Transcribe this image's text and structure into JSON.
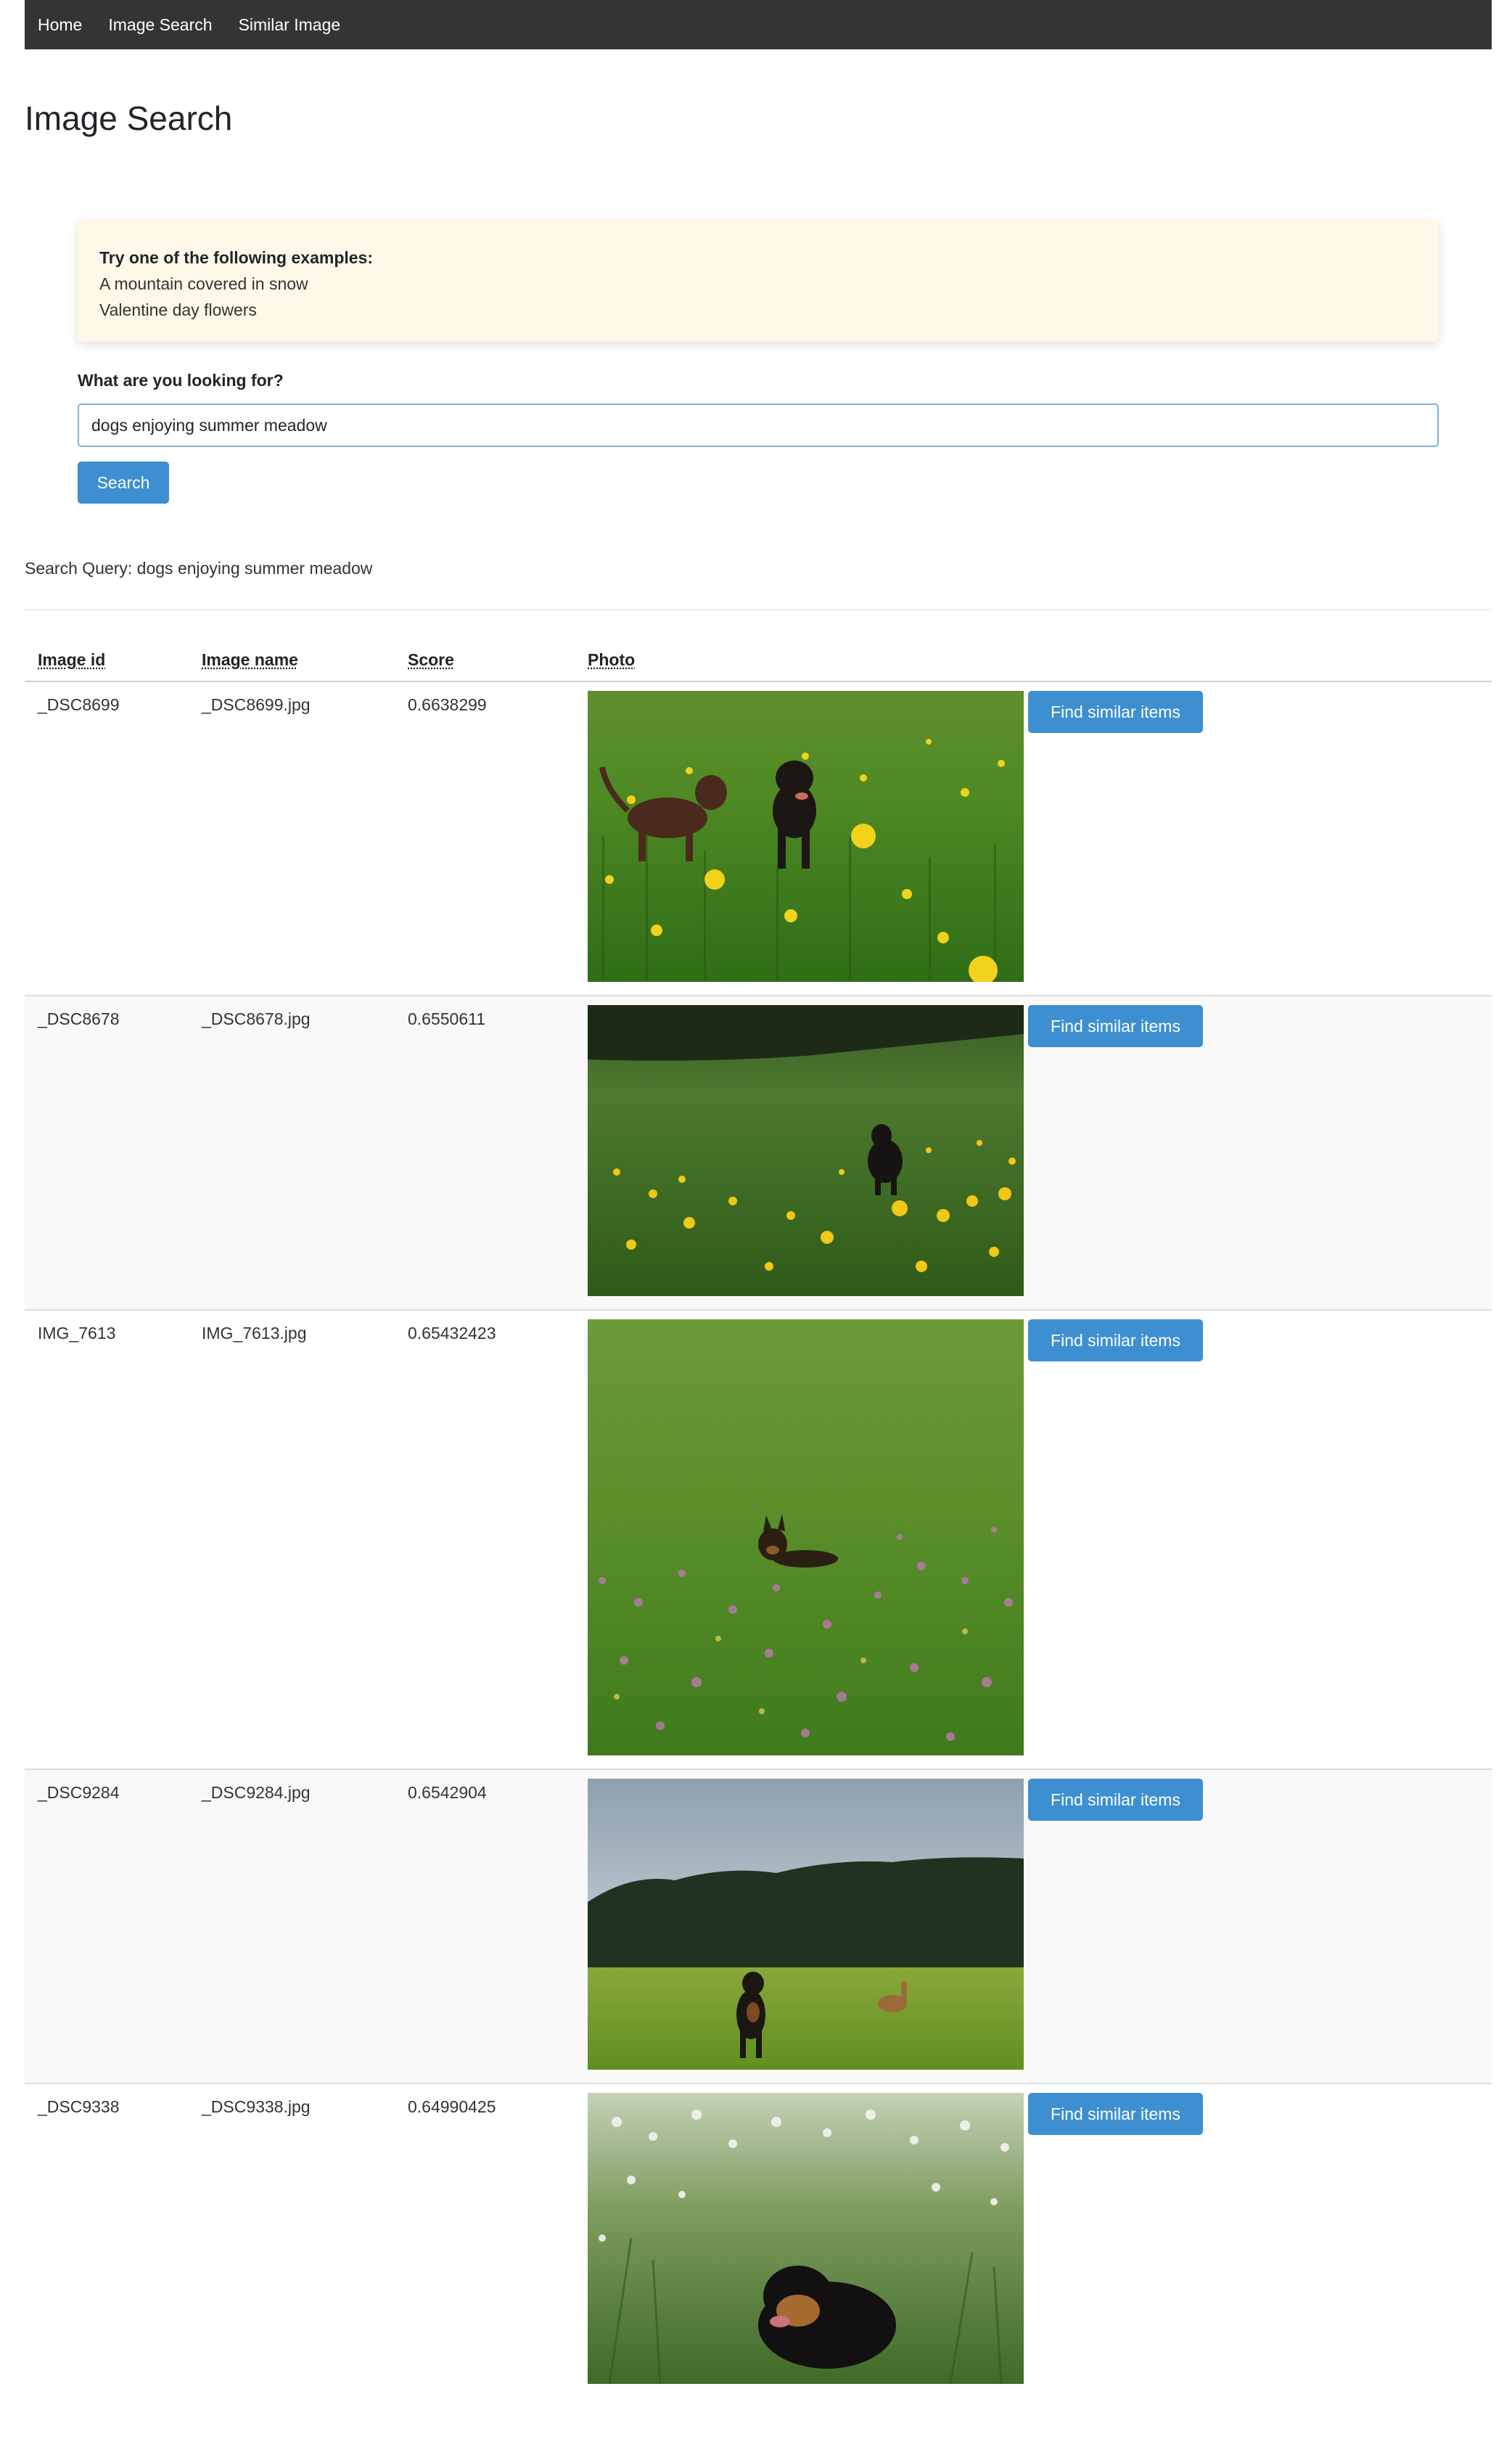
{
  "nav": {
    "items": [
      {
        "label": "Home"
      },
      {
        "label": "Image Search"
      },
      {
        "label": "Similar Image"
      }
    ]
  },
  "page": {
    "title": "Image Search"
  },
  "examples": {
    "heading": "Try one of the following examples:",
    "items": [
      "A mountain covered in snow",
      "Valentine day flowers"
    ]
  },
  "search": {
    "label": "What are you looking for?",
    "value": "dogs enjoying summer meadow",
    "button_label": "Search"
  },
  "query": {
    "text": "Search Query: dogs enjoying summer meadow"
  },
  "table": {
    "headers": [
      "Image id",
      "Image name",
      "Score",
      "Photo"
    ],
    "action_label": "Find similar items",
    "rows": [
      {
        "id": "_DSC8699",
        "name": "_DSC8699.jpg",
        "score": "0.6638299"
      },
      {
        "id": "_DSC8678",
        "name": "_DSC8678.jpg",
        "score": "0.6550611"
      },
      {
        "id": "IMG_7613",
        "name": "IMG_7613.jpg",
        "score": "0.65432423"
      },
      {
        "id": "_DSC9284",
        "name": "_DSC9284.jpg",
        "score": "0.6542904"
      },
      {
        "id": "_DSC9338",
        "name": "_DSC9338.jpg",
        "score": "0.64990425"
      }
    ]
  },
  "colors": {
    "navbar": "#343434",
    "accent": "#3d8fd1",
    "examples_bg": "#fff8e8"
  }
}
